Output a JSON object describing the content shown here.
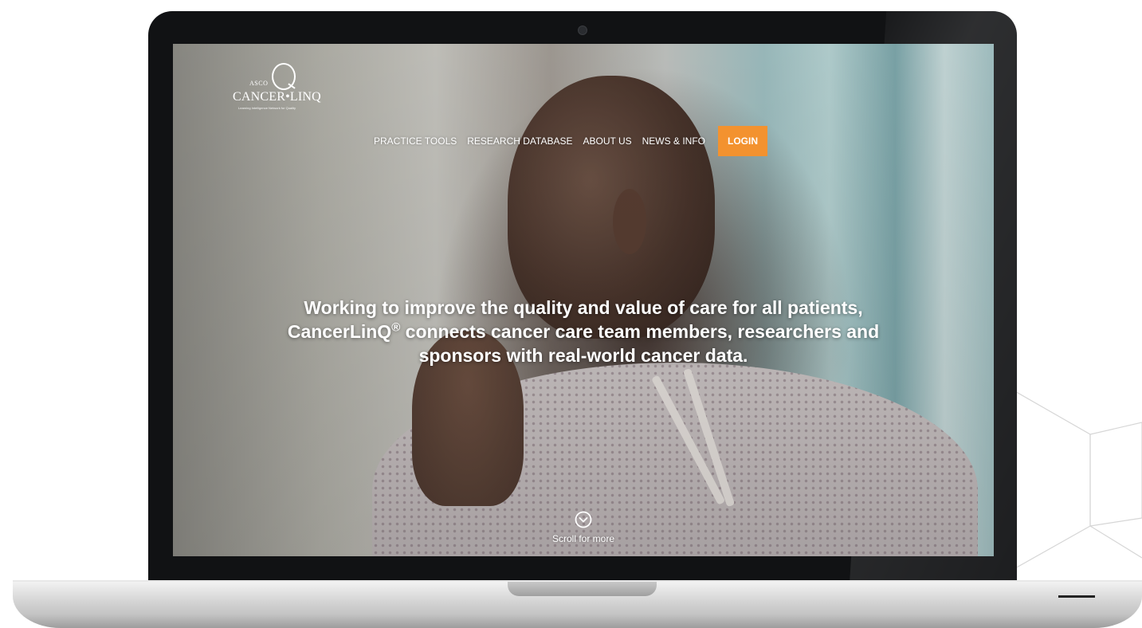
{
  "logo": {
    "org": "ASCO",
    "name": "CANCER•LINQ",
    "tagline": "Learning Intelligence Network for Quality"
  },
  "nav": {
    "items": [
      {
        "label": "PRACTICE TOOLS"
      },
      {
        "label": "RESEARCH DATABASE"
      },
      {
        "label": "ABOUT US"
      },
      {
        "label": "NEWS & INFO"
      }
    ],
    "login_label": "LOGIN"
  },
  "hero": {
    "line1": "Working to improve the quality and value of care for all patients,",
    "line2_brand": "CancerLinQ",
    "line2_reg": "®",
    "line2_rest": " connects cancer care team members, researchers and",
    "line3": "sponsors with real-world cancer data."
  },
  "scroll": {
    "label": "Scroll for more",
    "icon": "chevron-down-circle-icon"
  },
  "colors": {
    "accent": "#f3922f",
    "text": "#ffffff",
    "bezel": "#111214"
  }
}
